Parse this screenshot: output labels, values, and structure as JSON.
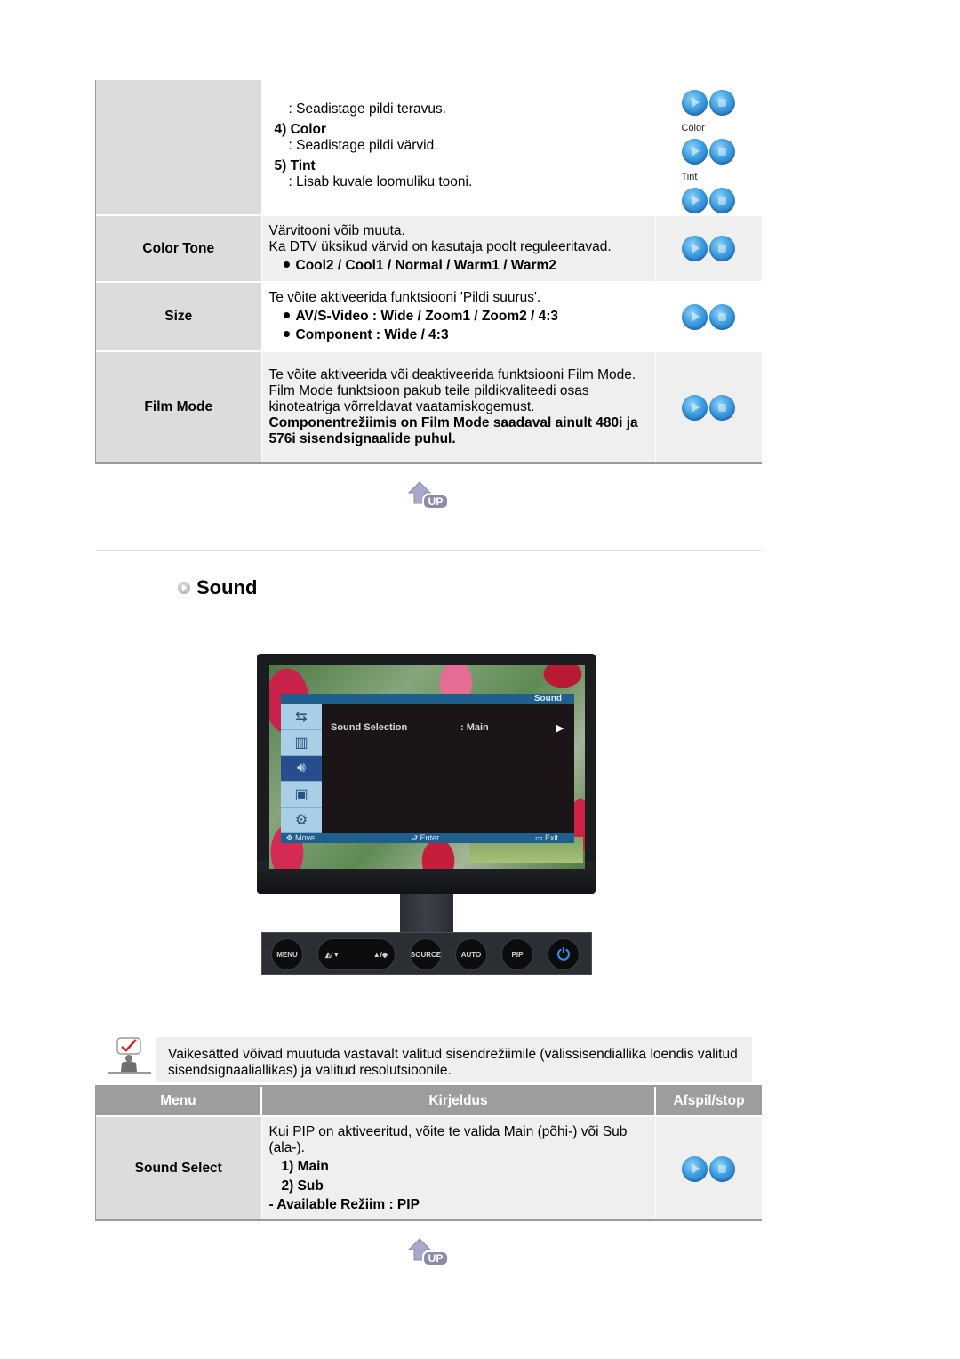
{
  "picture_table": {
    "rows": [
      {
        "menu": "",
        "lines": [
          {
            "type": "sub",
            "text": ": Seadistage pildi teravus."
          },
          {
            "type": "head",
            "text": "4) Color"
          },
          {
            "type": "sub",
            "text": ": Seadistage pildi värvid."
          },
          {
            "type": "head",
            "text": "5) Tint"
          },
          {
            "type": "sub",
            "text": ": Lisab kuvale loomuliku tooni."
          }
        ],
        "button_labels": [
          "Color",
          "Tint"
        ]
      },
      {
        "menu": "Color Tone",
        "text1": "Värvitooni võib muuta.",
        "text2": "Ka DTV üksikud värvid on kasutaja poolt reguleeritavad.",
        "bullets": [
          "Cool2 / Cool1 / Normal / Warm1 / Warm2"
        ]
      },
      {
        "menu": "Size",
        "text1": "Te võite aktiveerida funktsiooni 'Pildi suurus'.",
        "bullets": [
          "AV/S-Video : Wide / Zoom1 / Zoom2 / 4:3",
          "Component : Wide / 4:3"
        ]
      },
      {
        "menu": "Film Mode",
        "text1": "Te võite aktiveerida või deaktiveerida funktsiooni Film Mode.",
        "text2": "Film Mode funktsioon pakub teile pildikvaliteedi osas kinoteatriga võrreldavat vaatamiskogemust.",
        "bold": "Componentrežiimis on Film Mode saadaval ainult 480i ja 576i sisendsignaalide puhul."
      }
    ]
  },
  "up_link": {
    "icon": "up-arrow-icon",
    "label": "UP"
  },
  "section": {
    "title": "Sound",
    "icon": "circle-arrow-bullet-icon"
  },
  "monitor": {
    "osd": {
      "title": "Sound",
      "item_label": "Sound Selection",
      "item_value": ": Main",
      "item_arrow": "▶",
      "tabs": [
        "input-icon",
        "picture-icon",
        "sound-icon",
        "pip-icon",
        "setup-icon"
      ],
      "active_tab": 2,
      "footer": {
        "move": "Move",
        "enter": "Enter",
        "exit": "Exit"
      }
    },
    "panel_buttons": [
      "MENU",
      "◭/▼",
      "▲/◈",
      "SOURCE",
      "AUTO",
      "PIP",
      "⏻"
    ]
  },
  "note": {
    "icon": "note-checkmark-icon",
    "text": "Vaikesätted võivad muutuda vastavalt valitud sisendrežiimile (välissisendiallika loendis valitud sisendsignaaliallikas) ja valitud resolutsioonile."
  },
  "sound_table": {
    "headers": [
      "Menu",
      "Kirjeldus",
      "Afspil/stop"
    ],
    "rows": [
      {
        "menu": "Sound Select",
        "text1": "Kui PIP on aktiveeritud, võite te valida Main (põhi-) või Sub (ala-).",
        "items": [
          "1) Main",
          "2) Sub"
        ],
        "available": "- Available Režiim : PIP"
      }
    ]
  }
}
